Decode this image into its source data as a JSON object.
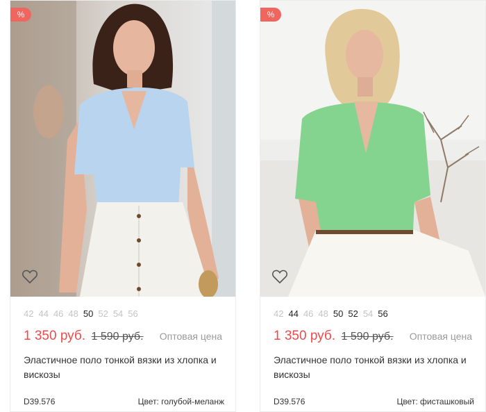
{
  "products": [
    {
      "badge": "%",
      "sizes": [
        {
          "label": "42",
          "available": false
        },
        {
          "label": "44",
          "available": false
        },
        {
          "label": "46",
          "available": false
        },
        {
          "label": "48",
          "available": false
        },
        {
          "label": "50",
          "available": true
        },
        {
          "label": "52",
          "available": false
        },
        {
          "label": "54",
          "available": false
        },
        {
          "label": "56",
          "available": false
        }
      ],
      "price": "1 350 руб.",
      "old_price": "1 590 руб.",
      "price_type": "Оптовая цена",
      "title": "Эластичное поло тонкой вязки из хлопка и вискозы",
      "sku": "D39.576",
      "color": "Цвет: голубой-меланж",
      "shirt_color": "#b9d4ee"
    },
    {
      "badge": "%",
      "sizes": [
        {
          "label": "42",
          "available": false
        },
        {
          "label": "44",
          "available": true
        },
        {
          "label": "46",
          "available": false
        },
        {
          "label": "48",
          "available": false
        },
        {
          "label": "50",
          "available": true
        },
        {
          "label": "52",
          "available": true
        },
        {
          "label": "54",
          "available": false
        },
        {
          "label": "56",
          "available": true
        }
      ],
      "price": "1 350 руб.",
      "old_price": "1 590 руб.",
      "price_type": "Оптовая цена",
      "title": "Эластичное поло тонкой вязки из хлопка и вискозы",
      "sku": "D39.576",
      "color": "Цвет: фисташковый",
      "shirt_color": "#84d38f"
    }
  ],
  "colors": {
    "price": "#ef4a4a",
    "badge": "#f0655e",
    "size_available": "#222222",
    "size_unavailable": "#c4c4c4"
  },
  "icons": {
    "favorite": "heart-outline-icon"
  }
}
